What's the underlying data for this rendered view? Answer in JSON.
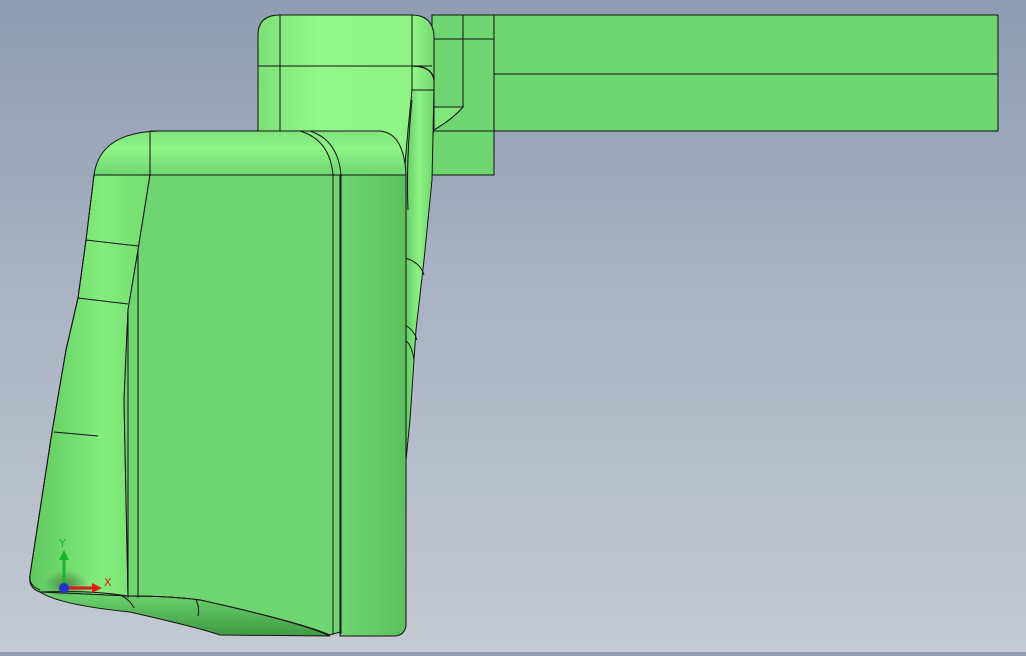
{
  "viewport": {
    "background_top": "#8e9db2",
    "background_bottom": "#c4c9d3"
  },
  "part": {
    "face_color": "#6ed571",
    "lit_face_color": "#8ef284",
    "edge_color": "#111111"
  },
  "triad": {
    "x_label": "X",
    "y_label": "Y",
    "x_axis_color": "#e01b1b",
    "y_axis_color": "#19b52a",
    "z_axis_color": "#2335c9"
  }
}
